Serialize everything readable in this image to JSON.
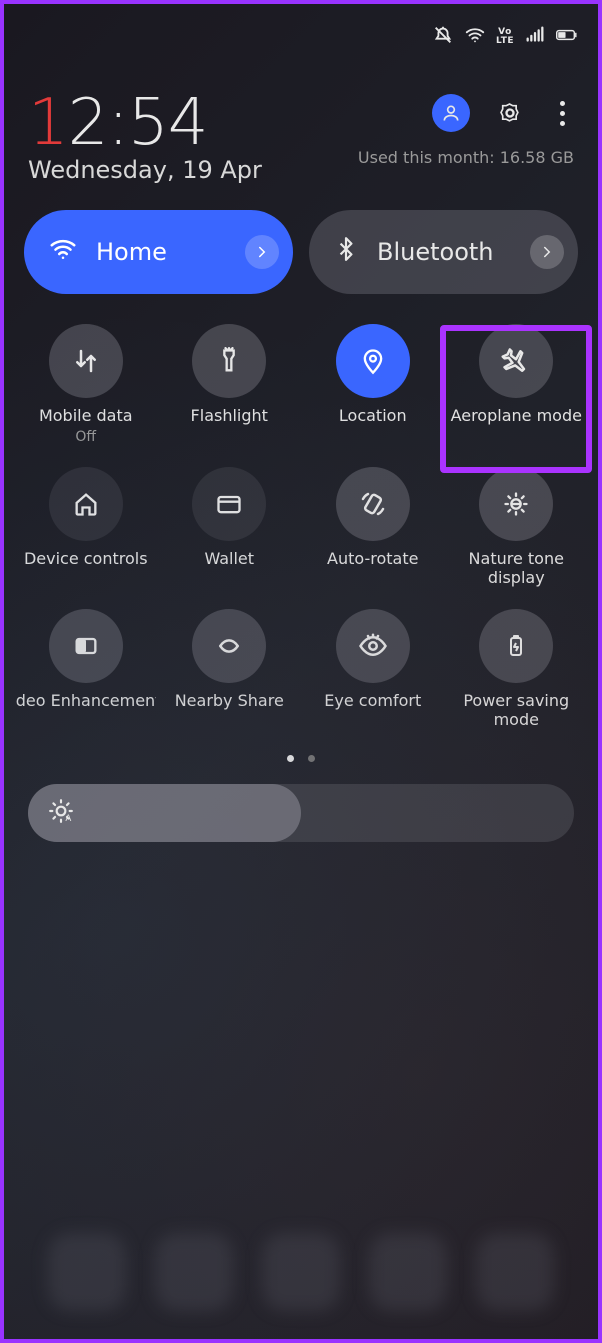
{
  "status": {
    "volte": "Vo LTE"
  },
  "clock": {
    "hour_leading": "1",
    "time_rest": "2:54",
    "date": "Wednesday, 19 Apr"
  },
  "header": {
    "usage": "Used this month: 16.58 GB"
  },
  "pills": {
    "wifi": {
      "label": "Home"
    },
    "bluetooth": {
      "label": "Bluetooth"
    }
  },
  "tiles": [
    {
      "label": "Mobile data",
      "sub": "Off",
      "state": "normal",
      "icon": "data-arrows"
    },
    {
      "label": "Flashlight",
      "sub": "",
      "state": "normal",
      "icon": "flashlight"
    },
    {
      "label": "Location",
      "sub": "",
      "state": "active",
      "icon": "location"
    },
    {
      "label": "Aeroplane mode",
      "sub": "",
      "state": "normal",
      "icon": "airplane",
      "highlight": true
    },
    {
      "label": "Device controls",
      "sub": "",
      "state": "disabled",
      "icon": "house"
    },
    {
      "label": "Wallet",
      "sub": "",
      "state": "disabled",
      "icon": "wallet"
    },
    {
      "label": "Auto-rotate",
      "sub": "",
      "state": "normal",
      "icon": "rotate"
    },
    {
      "label": "Nature tone display",
      "sub": "",
      "state": "normal",
      "icon": "sun",
      "wrap": true
    },
    {
      "label": "deo Enhancement",
      "sub": "",
      "state": "normal",
      "icon": "enhance"
    },
    {
      "label": "Nearby Share",
      "sub": "",
      "state": "normal",
      "icon": "nearby"
    },
    {
      "label": "Eye comfort",
      "sub": "",
      "state": "normal",
      "icon": "eye"
    },
    {
      "label": "Power saving mode",
      "sub": "",
      "state": "normal",
      "icon": "battery",
      "wrap": true
    }
  ],
  "highlight_tile_index": 3,
  "colors": {
    "accent": "#3a66ff",
    "highlight_border": "#aa33ff",
    "outer_border": "#9933ff",
    "clock_red": "#e23a3a"
  }
}
